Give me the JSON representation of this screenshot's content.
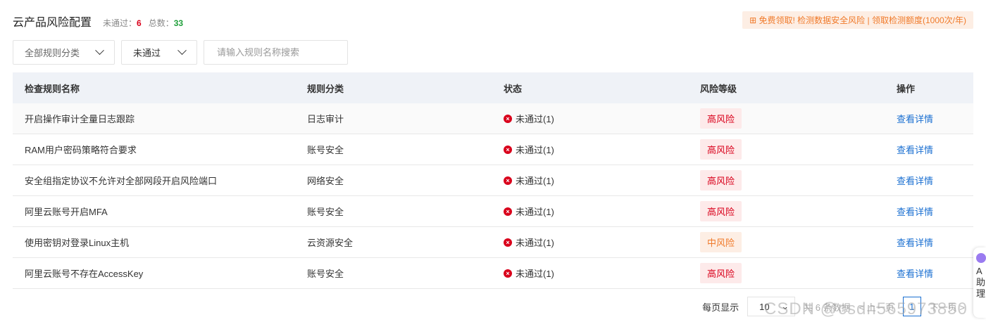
{
  "header": {
    "title": "云产品风险配置",
    "failed_label": "未通过：",
    "failed_count": "6",
    "total_label": "总数：",
    "total_count": "33"
  },
  "promo": "免费领取! 检测数据安全风险 | 领取检测额度(1000次/年)",
  "filters": {
    "category": "全部规则分类",
    "status": "未通过",
    "search_placeholder": "请输入规则名称搜索"
  },
  "table": {
    "columns": [
      "检查规则名称",
      "规则分类",
      "状态",
      "风险等级",
      "操作"
    ],
    "rows": [
      {
        "name": "开启操作审计全量日志跟踪",
        "category": "日志审计",
        "status": "未通过(1)",
        "risk": "高风险",
        "level": "high",
        "action": "查看详情"
      },
      {
        "name": "RAM用户密码策略符合要求",
        "category": "账号安全",
        "status": "未通过(1)",
        "risk": "高风险",
        "level": "high",
        "action": "查看详情"
      },
      {
        "name": "安全组指定协议不允许对全部网段开启风险端口",
        "category": "网络安全",
        "status": "未通过(1)",
        "risk": "高风险",
        "level": "high",
        "action": "查看详情"
      },
      {
        "name": "阿里云账号开启MFA",
        "category": "账号安全",
        "status": "未通过(1)",
        "risk": "高风险",
        "level": "high",
        "action": "查看详情"
      },
      {
        "name": "使用密钥对登录Linux主机",
        "category": "云资源安全",
        "status": "未通过(1)",
        "risk": "中风险",
        "level": "mid",
        "action": "查看详情"
      },
      {
        "name": "阿里云账号不存在AccessKey",
        "category": "账号安全",
        "status": "未通过(1)",
        "risk": "高风险",
        "level": "high",
        "action": "查看详情"
      }
    ]
  },
  "pagination": {
    "page_size_label": "每页显示",
    "page_size": "10",
    "total": "共 6 条数据",
    "prev": "< 上一页",
    "current": "1",
    "next": "下一页 >"
  },
  "watermark": "CSDN @csdn565973850",
  "widget": {
    "text": "A 助 理"
  }
}
